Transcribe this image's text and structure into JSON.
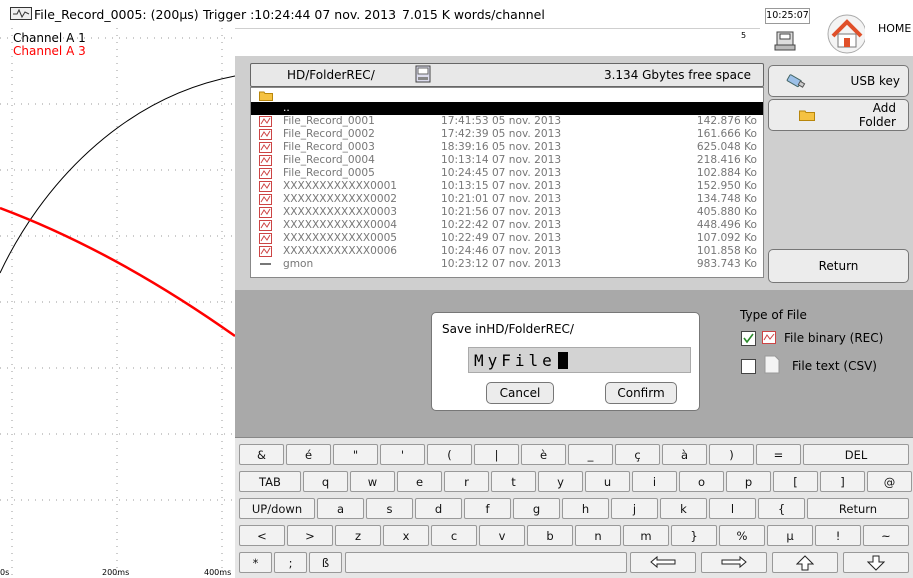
{
  "topbar": {
    "file": "File_Record_0005: (200µs)",
    "trigger": "Trigger :10:24:44 07 nov. 2013",
    "rate": "7.015 K words/channel",
    "clock": "10:25:07",
    "home": "HOME",
    "tick_5": "5"
  },
  "channels": {
    "a1": "Channel A 1",
    "a3": "Channel A 3",
    "a1_color": "#000000",
    "a3_color": "#ff0000"
  },
  "x_axis": {
    "t0": "0s",
    "t1": "200ms",
    "t2": "400ms"
  },
  "browser": {
    "path": "HD/FolderREC/",
    "free_space": "3.134 Gbytes free space",
    "parent": "..",
    "files": [
      {
        "name": "File_Record_0001",
        "date": "17:41:53 05 nov. 2013",
        "size": "142.876 Ko"
      },
      {
        "name": "File_Record_0002",
        "date": "17:42:39 05 nov. 2013",
        "size": "161.666 Ko"
      },
      {
        "name": "File_Record_0003",
        "date": "18:39:16 05 nov. 2013",
        "size": "625.048 Ko"
      },
      {
        "name": "File_Record_0004",
        "date": "10:13:14 07 nov. 2013",
        "size": "218.416 Ko"
      },
      {
        "name": "File_Record_0005",
        "date": "10:24:45 07 nov. 2013",
        "size": "102.884 Ko"
      },
      {
        "name": "XXXXXXXXXXXX0001",
        "date": "10:13:15 07 nov. 2013",
        "size": "152.950 Ko"
      },
      {
        "name": "XXXXXXXXXXXX0002",
        "date": "10:21:01 07 nov. 2013",
        "size": "134.748 Ko"
      },
      {
        "name": "XXXXXXXXXXXX0003",
        "date": "10:21:56 07 nov. 2013",
        "size": "405.880 Ko"
      },
      {
        "name": "XXXXXXXXXXXX0004",
        "date": "10:22:42 07 nov. 2013",
        "size": "448.496 Ko"
      },
      {
        "name": "XXXXXXXXXXXX0005",
        "date": "10:22:49 07 nov. 2013",
        "size": "107.092 Ko"
      },
      {
        "name": "XXXXXXXXXXXX0006",
        "date": "10:24:46 07 nov. 2013",
        "size": "101.858 Ko"
      },
      {
        "name": "gmon",
        "date": "10:23:12 07 nov. 2013",
        "size": "983.743 Ko"
      }
    ],
    "usb_label": "USB key",
    "add_label_1": "Add",
    "add_label_2": "Folder",
    "return_label": "Return"
  },
  "save_dialog": {
    "title": "Save inHD/FolderREC/",
    "filename": "MyFile",
    "cancel": "Cancel",
    "confirm": "Confirm"
  },
  "file_type": {
    "label": "Type of File",
    "binary": "File binary (REC)",
    "binary_checked": true,
    "text": "File text (CSV)",
    "text_checked": false
  },
  "keyboard": {
    "row1": [
      "&",
      "é",
      "\"",
      "'",
      "(",
      "|",
      "è",
      "_",
      "ç",
      "à",
      ")",
      "=",
      "DEL"
    ],
    "row2": [
      "TAB",
      "q",
      "w",
      "e",
      "r",
      "t",
      "y",
      "u",
      "i",
      "o",
      "p",
      "[",
      "]",
      "@"
    ],
    "row3": [
      "UP/down",
      "a",
      "s",
      "d",
      "f",
      "g",
      "h",
      "j",
      "k",
      "l",
      "{",
      "Return"
    ],
    "row4": [
      "<",
      ">",
      "z",
      "x",
      "c",
      "v",
      "b",
      "n",
      "m",
      "}",
      "%",
      "µ",
      "!",
      "~"
    ],
    "row5": [
      "*",
      ";",
      "ß"
    ]
  }
}
